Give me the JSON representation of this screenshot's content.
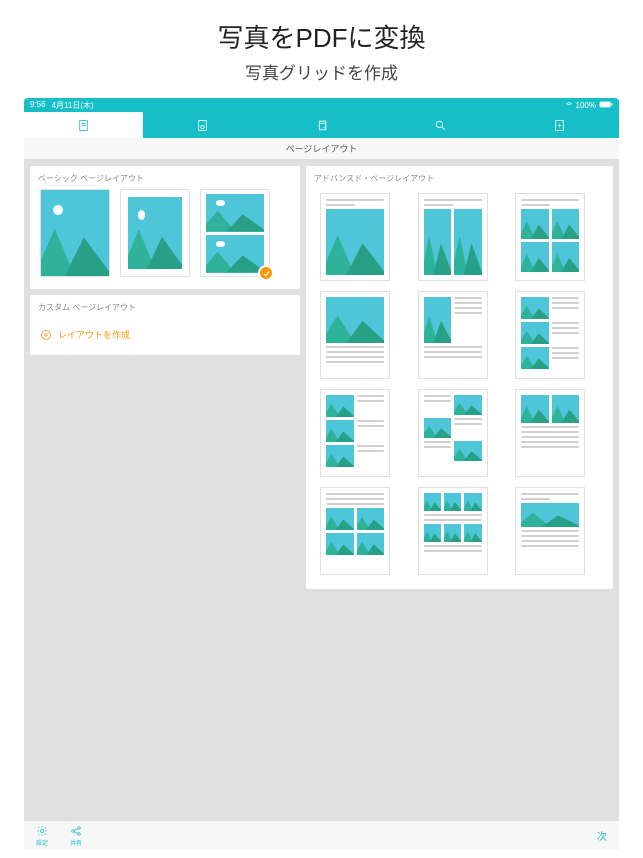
{
  "marketing": {
    "title": "写真をPDFに変換",
    "subtitle": "写真グリッドを作成"
  },
  "status": {
    "time": "9:56",
    "date": "4月11日(木)",
    "battery": "100%"
  },
  "subheader": "ページレイアウト",
  "sections": {
    "basic": "ベーシック ページレイアウト",
    "custom": "カスタム ページレイアウト",
    "advanced": "アドバンスド・ページレイアウト"
  },
  "create_layout": "レイアウトを作成",
  "bottom": {
    "settings": "設定",
    "share": "共有",
    "next": "次"
  }
}
